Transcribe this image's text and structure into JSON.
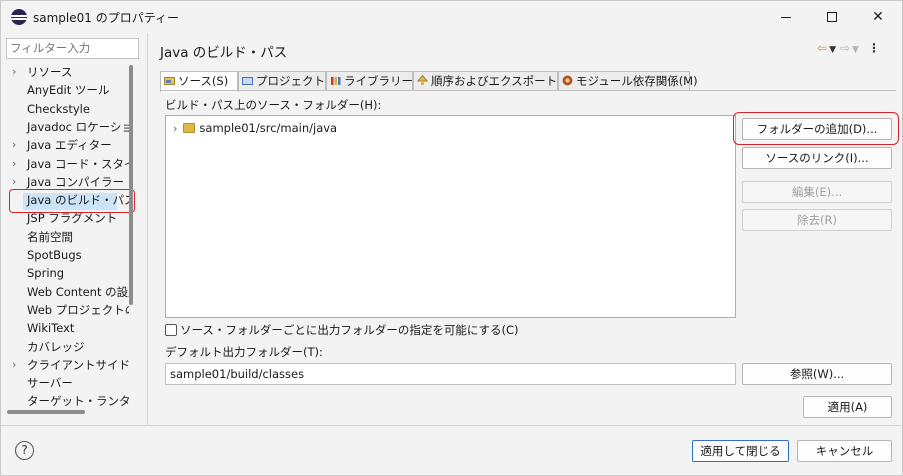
{
  "window": {
    "title": "sample01 のプロパティー",
    "minimize": "—",
    "maximize": "□",
    "close": "✕"
  },
  "sidebar": {
    "filter_placeholder": "フィルター入力",
    "items": [
      {
        "label": "リソース",
        "expandable": true
      },
      {
        "label": "AnyEdit ツール",
        "expandable": false
      },
      {
        "label": "Checkstyle",
        "expandable": false
      },
      {
        "label": "Javadoc ロケーション",
        "expandable": false
      },
      {
        "label": "Java エディター",
        "expandable": true
      },
      {
        "label": "Java コード・スタイル",
        "expandable": true
      },
      {
        "label": "Java コンパイラー",
        "expandable": true
      },
      {
        "label": "Java のビルド・パス",
        "expandable": false,
        "selected": true
      },
      {
        "label": "JSP フラグメント",
        "expandable": false
      },
      {
        "label": "名前空間",
        "expandable": false
      },
      {
        "label": "SpotBugs",
        "expandable": false
      },
      {
        "label": "Spring",
        "expandable": false
      },
      {
        "label": "Web Content の設定",
        "expandable": false
      },
      {
        "label": "Web プロジェクトの設定",
        "expandable": false
      },
      {
        "label": "WikiText",
        "expandable": false
      },
      {
        "label": "カバレッジ",
        "expandable": false
      },
      {
        "label": "クライアントサイド JavaScript",
        "expandable": true
      },
      {
        "label": "サーバー",
        "expandable": false
      },
      {
        "label": "ターゲット・ランタイム",
        "expandable": false
      }
    ]
  },
  "main": {
    "title": "Java のビルド・パス",
    "tabs": [
      {
        "label": "ソース(S)",
        "icon": "source-folder-icon",
        "active": true
      },
      {
        "label": "プロジェクト(P)",
        "icon": "project-icon",
        "active": false
      },
      {
        "label": "ライブラリー(L)",
        "icon": "library-icon",
        "active": false
      },
      {
        "label": "順序およびエクスポート(O)",
        "icon": "order-export-icon",
        "active": false
      },
      {
        "label": "モジュール依存関係(M)",
        "icon": "module-icon",
        "active": false
      }
    ],
    "source_folders_label": "ビルド・パス上のソース・フォルダー(H):",
    "source_folders": [
      "sample01/src/main/java"
    ],
    "buttons": {
      "add_folder": "フォルダーの追加(D)...",
      "link_source": "ソースのリンク(I)...",
      "edit": "編集(E)...",
      "remove": "除去(R)"
    },
    "allow_output_folders_label": "ソース・フォルダーごとに出力フォルダーの指定を可能にする(C)",
    "allow_output_folders_checked": false,
    "default_output_label": "デフォルト出力フォルダー(T):",
    "default_output_value": "sample01/build/classes",
    "browse_button": "参照(W)...",
    "apply_button": "適用(A)"
  },
  "footer": {
    "help_symbol": "?",
    "apply_close_button": "適用して閉じる",
    "cancel_button": "キャンセル"
  },
  "colors": {
    "highlight_outline": "#d6242f",
    "selection_bg": "#cde3f6",
    "default_button_border": "#2f6fc8"
  }
}
